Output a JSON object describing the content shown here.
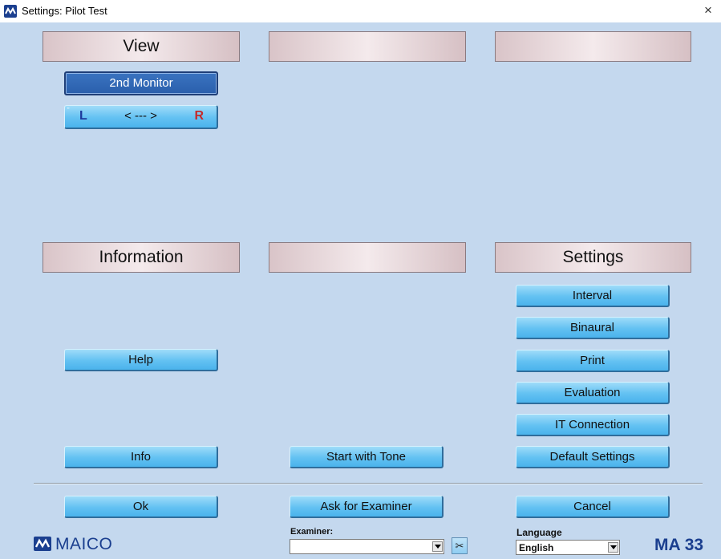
{
  "window": {
    "title": "Settings: Pilot Test",
    "close_glyph": "×",
    "icon": "maico-icon"
  },
  "panels": {
    "view": "View",
    "top_middle": "",
    "top_right": "",
    "information": "Information",
    "bottom_middle": "",
    "settings": "Settings"
  },
  "view": {
    "monitor_button": "2nd Monitor",
    "lr_button": {
      "left": "L",
      "arrow": "< --- >",
      "right": "R",
      "marker": "\""
    }
  },
  "information": {
    "help": "Help",
    "info": "Info"
  },
  "middle": {
    "start_with_tone": "Start with Tone"
  },
  "settings": {
    "interval": "Interval",
    "binaural": "Binaural",
    "print": "Print",
    "evaluation": "Evaluation",
    "it_connection": "IT Connection",
    "default_settings": "Default Settings"
  },
  "footer": {
    "ok": "Ok",
    "ask_for_examiner": "Ask for Examiner",
    "cancel": "Cancel",
    "examiner_label": "Examiner:",
    "examiner_value": "",
    "scissors_glyph": "✂",
    "language_label": "Language",
    "language_value": "English",
    "logo": "MAICO",
    "model": "MA 33"
  },
  "colors": {
    "background": "#c4d8ee",
    "button": "#63c1f2",
    "selected_button": "#2a5fac",
    "brand": "#1b3f8f",
    "right_red": "#c52a2a"
  }
}
